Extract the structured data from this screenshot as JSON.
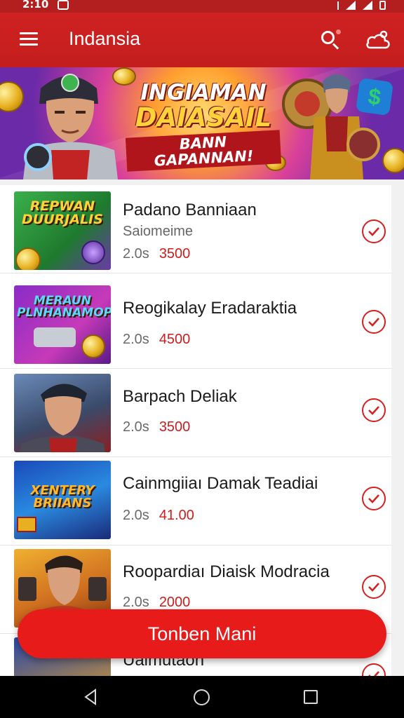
{
  "status_bar": {
    "time": "2:10"
  },
  "app_bar": {
    "title": "Indansia"
  },
  "banner": {
    "line1": "INGIAMAN",
    "line2": "DAIASAIL",
    "line3": "BANN GAPANNAN!"
  },
  "items": [
    {
      "thumb_title": "REPWAN DUURJALIS",
      "title": "Padano Banniaan",
      "subtitle": "Saiomeime",
      "duration": "2.0s",
      "price": "3500"
    },
    {
      "thumb_title": "MERAUN PLNHANAMOP",
      "title": "Reogikalay Eradaraktia",
      "subtitle": "",
      "duration": "2.0s",
      "price": "4500"
    },
    {
      "thumb_title": "",
      "title": "Barpach Deliak",
      "subtitle": "",
      "duration": "2.0s",
      "price": "3500"
    },
    {
      "thumb_title": "XENTERY BRIIANS",
      "title": "Cainmgiiaı Damak Teadiai",
      "subtitle": "",
      "duration": "2.0s",
      "price": "41.00"
    },
    {
      "thumb_title": "",
      "title": "Roopardiaı Diaisk Modracia",
      "subtitle": "",
      "duration": "2.0s",
      "price": "2000"
    },
    {
      "thumb_title": "",
      "title": "Uaimutaon",
      "subtitle": "",
      "duration": "",
      "price": ""
    }
  ],
  "cta": {
    "label": "Tonben Mani"
  },
  "colors": {
    "primary": "#c41d1d",
    "accent": "#e81b1b",
    "price": "#d01c1c"
  },
  "icons": [
    "menu-icon",
    "search-icon",
    "cloud-upload-icon",
    "check-circle-icon",
    "back-icon",
    "home-icon",
    "recents-icon"
  ]
}
